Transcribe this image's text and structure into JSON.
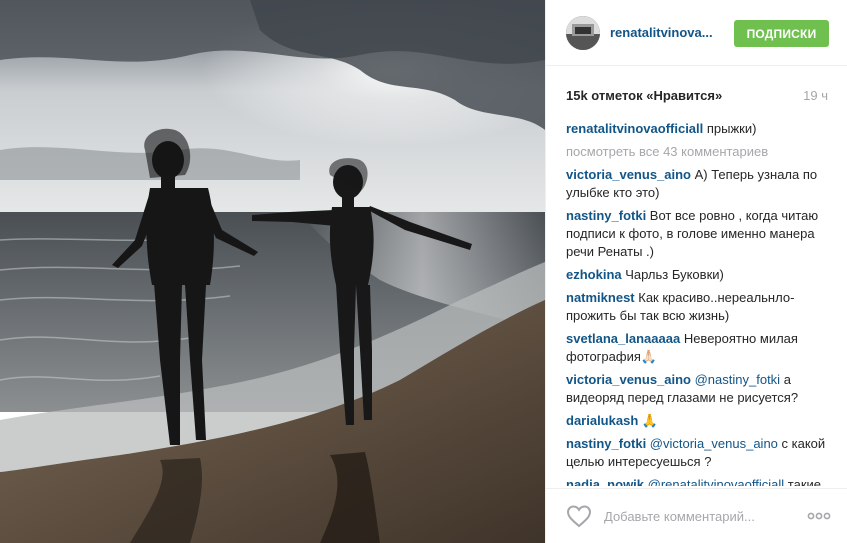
{
  "post": {
    "owner": "renatalitvinova...",
    "follow_label": "ПОДПИСКИ",
    "likes": "15k отметок «Нравится»",
    "time_ago": "19 ч"
  },
  "caption": {
    "user": "renatalitvinovaofficiall",
    "text": " прыжки)"
  },
  "load_more": "посмотреть все 43 комментариев",
  "comments": [
    {
      "user": "victoria_venus_aino",
      "text": " А) Теперь узнала по улыбке кто это)"
    },
    {
      "user": "nastiny_fotki",
      "text": " Вот все ровно , когда читаю подписи к фото, в голове именно манера речи Ренаты .)"
    },
    {
      "user": "ezhokina",
      "text": " Чарльз Буковки)"
    },
    {
      "user": "natmiknest",
      "text": " Как красиво..нереальнло-прожить бы так всю жизнь)"
    },
    {
      "user": "svetlana_lanaaaaa",
      "text": " Невероятно милая фотография🙏🏻"
    },
    {
      "user": "victoria_venus_aino",
      "mention": " @nastiny_fotki",
      "text": " а видеоряд перед глазами не рисуется?"
    },
    {
      "user": "darialukash",
      "text": " 🙏"
    },
    {
      "user": "nastiny_fotki",
      "mention": " @victoria_venus_aino",
      "text": " с какой целью интересуешься ?"
    },
    {
      "user": "nadja_nowik",
      "mention": " @renatalitvinovaofficiall",
      "text": " такие жизнерадостные!)) Здорово!"
    }
  ],
  "footer": {
    "comment_placeholder": "Добавьте комментарий...",
    "heart_icon": "heart-outline-icon",
    "more_icon": "ellipsis-icon"
  },
  "colors": {
    "link": "#125688",
    "follow_button": "#70c050",
    "muted": "#a5a7aa",
    "divider": "#efefef"
  }
}
